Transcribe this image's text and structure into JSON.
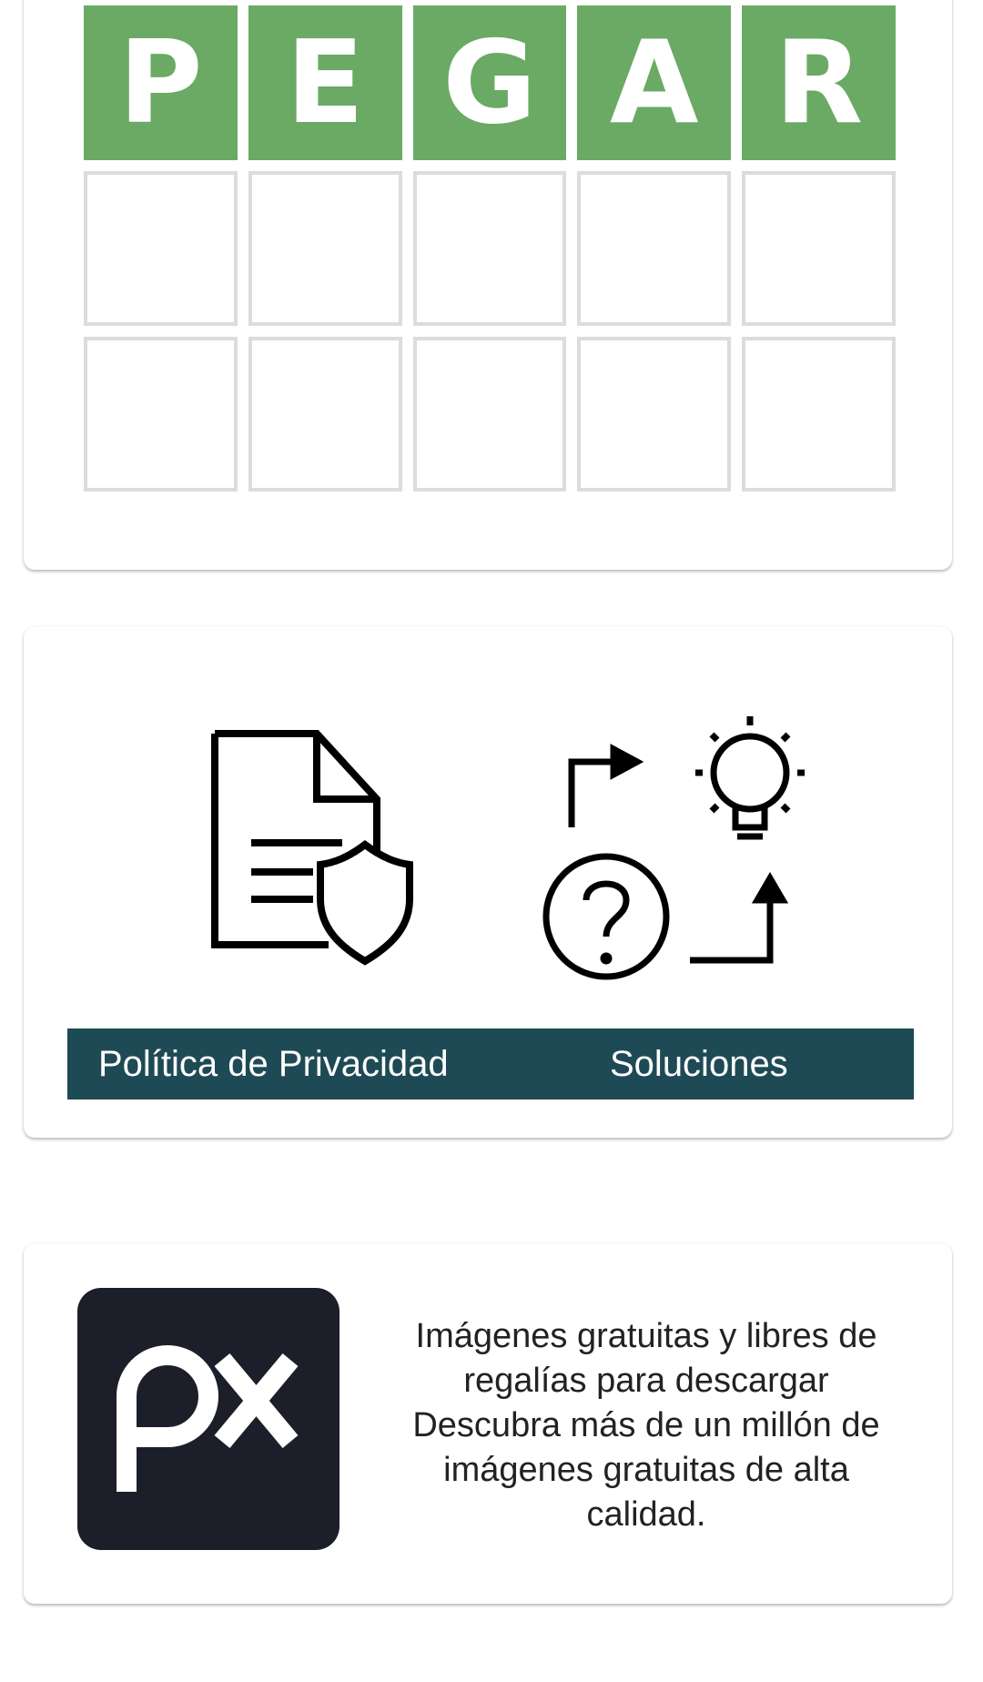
{
  "board": {
    "rows": [
      {
        "tiles": [
          "P",
          "E",
          "G",
          "A",
          "R"
        ],
        "state": "correct"
      },
      {
        "tiles": [
          "",
          "",
          "",
          "",
          ""
        ],
        "state": "empty"
      },
      {
        "tiles": [
          "",
          "",
          "",
          "",
          ""
        ],
        "state": "empty"
      }
    ],
    "colors": {
      "correct": "#6aaa64",
      "empty_border": "#dcdcdc"
    }
  },
  "links": {
    "privacy_label": "Política de Privacidad",
    "solutions_label": "Soluciones",
    "bar_color": "#1e4a55",
    "privacy_icon": "document-shield-icon",
    "solutions_icon": "question-lightbulb-icon"
  },
  "promo": {
    "logo_icon": "pixabay-px-logo",
    "logo_bg": "#1c1f2a",
    "text_lines": [
      "Imágenes gratuitas y libres de",
      "regalías para descargar",
      "Descubra más de un millón de",
      "imágenes gratuitas de alta",
      "calidad."
    ]
  }
}
